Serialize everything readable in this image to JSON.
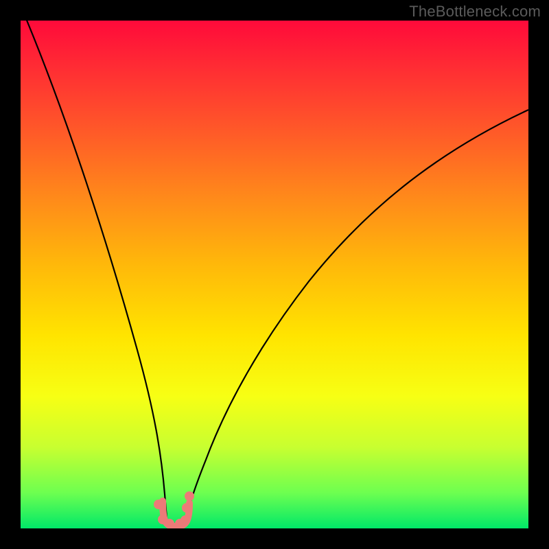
{
  "attribution": "TheBottleneck.com",
  "colors": {
    "dot": "#ec7a78",
    "curve": "#000000",
    "frame": "#000000"
  },
  "chart_data": {
    "type": "line",
    "title": "",
    "xlabel": "",
    "ylabel": "",
    "ylim": [
      0,
      100
    ],
    "xlim": [
      0,
      100
    ],
    "series": [
      {
        "name": "left-curve",
        "x": [
          0,
          5,
          10,
          15,
          20,
          23,
          25,
          26.5,
          27.5,
          28.3
        ],
        "values": [
          103,
          78,
          56,
          36,
          19,
          10,
          5,
          2.5,
          1.2,
          0.3
        ]
      },
      {
        "name": "right-curve",
        "x": [
          32.8,
          34,
          36,
          40,
          45,
          52,
          60,
          70,
          82,
          95,
          100
        ],
        "values": [
          0.3,
          1.5,
          4,
          10,
          18,
          28,
          40,
          53,
          66,
          78,
          82
        ]
      }
    ],
    "markers": {
      "name": "bottom-cluster",
      "color": "#ec7a78",
      "points": [
        {
          "x": 27.2,
          "y": 4.8
        },
        {
          "x": 28.0,
          "y": 1.7
        },
        {
          "x": 29.4,
          "y": 0.9
        },
        {
          "x": 31.3,
          "y": 0.9
        },
        {
          "x": 32.4,
          "y": 1.6
        },
        {
          "x": 32.7,
          "y": 4.1
        },
        {
          "x": 33.2,
          "y": 6.4
        }
      ]
    },
    "u_connector": {
      "start_x": 28.3,
      "end_x": 32.4,
      "bottom_y": 0.0
    }
  }
}
